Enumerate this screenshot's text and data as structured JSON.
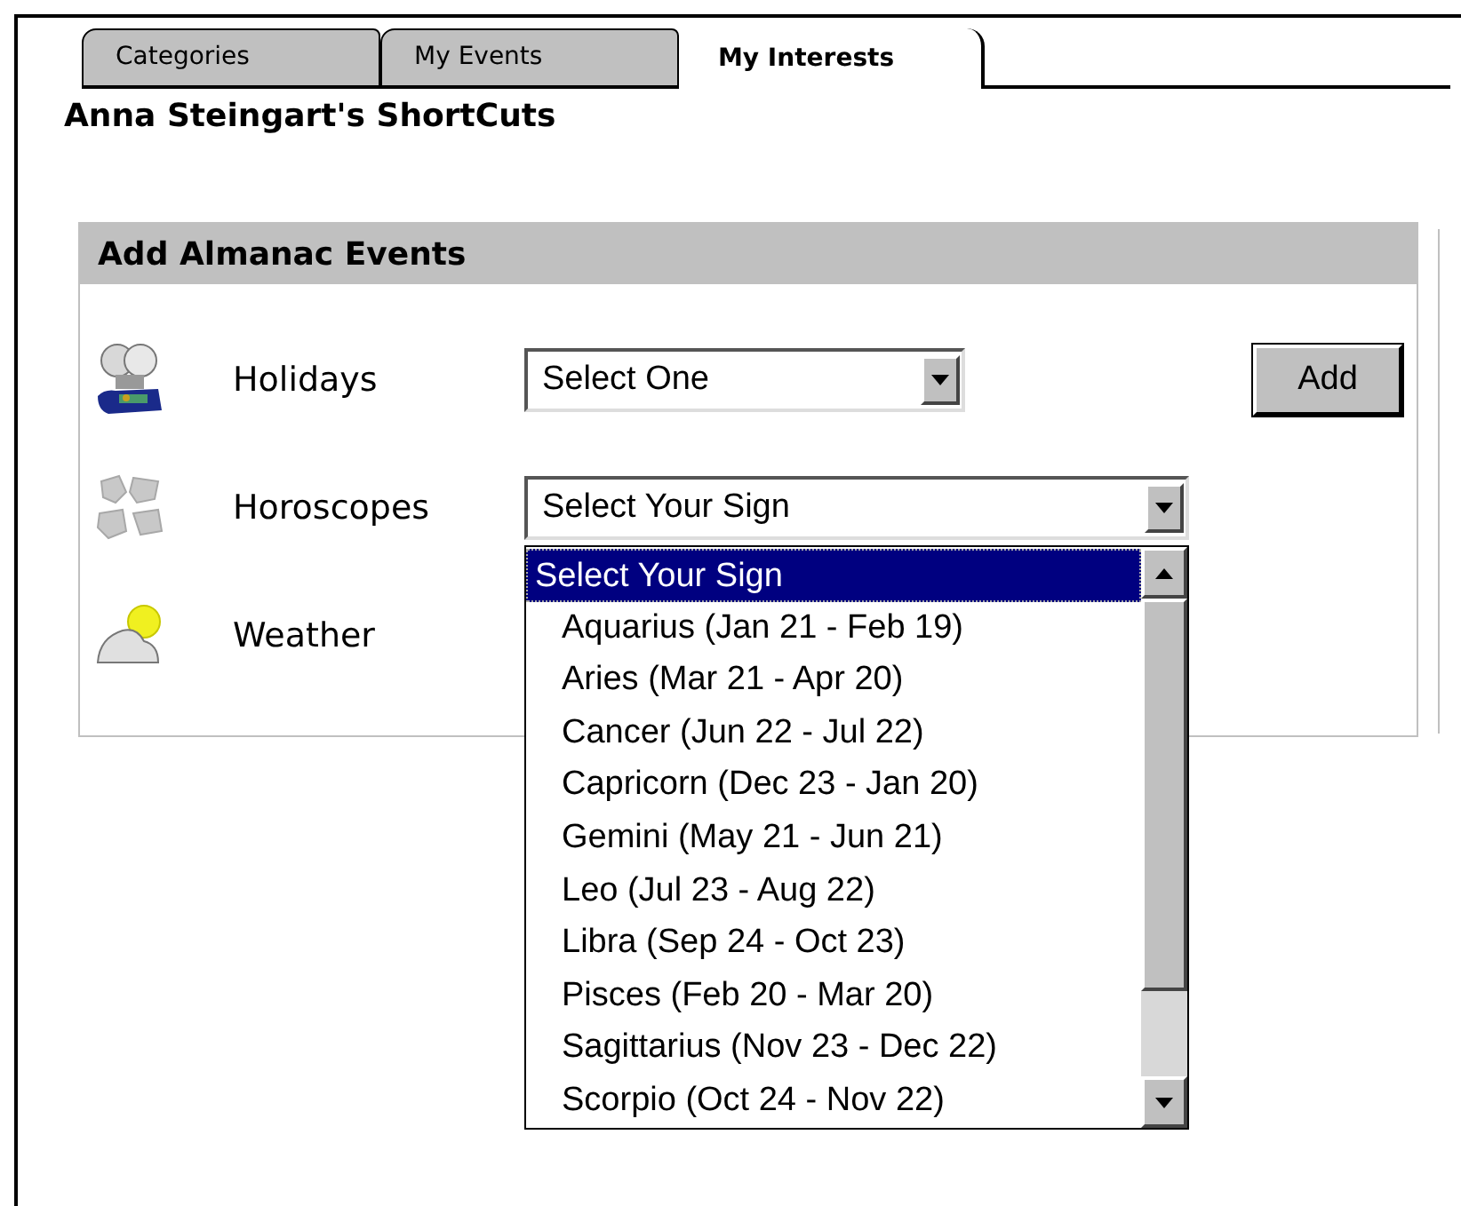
{
  "tabs": [
    {
      "label": "Categories",
      "selected": false
    },
    {
      "label": "My Events",
      "selected": false
    },
    {
      "label": "My Interests",
      "selected": true
    }
  ],
  "heading": "Anna Steingart's ShortCuts",
  "panel": {
    "title": "Add Almanac Events",
    "rows": [
      {
        "kind": "holidays",
        "label": "Holidays",
        "select": "Select One",
        "button": "Add"
      },
      {
        "kind": "horoscopes",
        "label": "Horoscopes",
        "select": "Select Your Sign",
        "expanded": true,
        "options": [
          {
            "label": "Select Your Sign",
            "selected": true
          },
          {
            "label": "Aquarius (Jan 21 - Feb 19)",
            "selected": false
          },
          {
            "label": "Aries (Mar 21 - Apr 20)",
            "selected": false
          },
          {
            "label": "Cancer (Jun 22 - Jul 22)",
            "selected": false
          },
          {
            "label": "Capricorn (Dec 23 - Jan 20)",
            "selected": false
          },
          {
            "label": "Gemini (May 21 - Jun 21)",
            "selected": false
          },
          {
            "label": "Leo (Jul 23 - Aug 22)",
            "selected": false
          },
          {
            "label": "Libra (Sep 24 - Oct 23)",
            "selected": false
          },
          {
            "label": "Pisces (Feb 20 - Mar 20)",
            "selected": false
          },
          {
            "label": "Sagittarius (Nov 23 - Dec 22)",
            "selected": false
          },
          {
            "label": "Scorpio (Oct 24 - Nov 22)",
            "selected": false
          }
        ]
      },
      {
        "kind": "weather",
        "label": "Weather"
      }
    ]
  }
}
